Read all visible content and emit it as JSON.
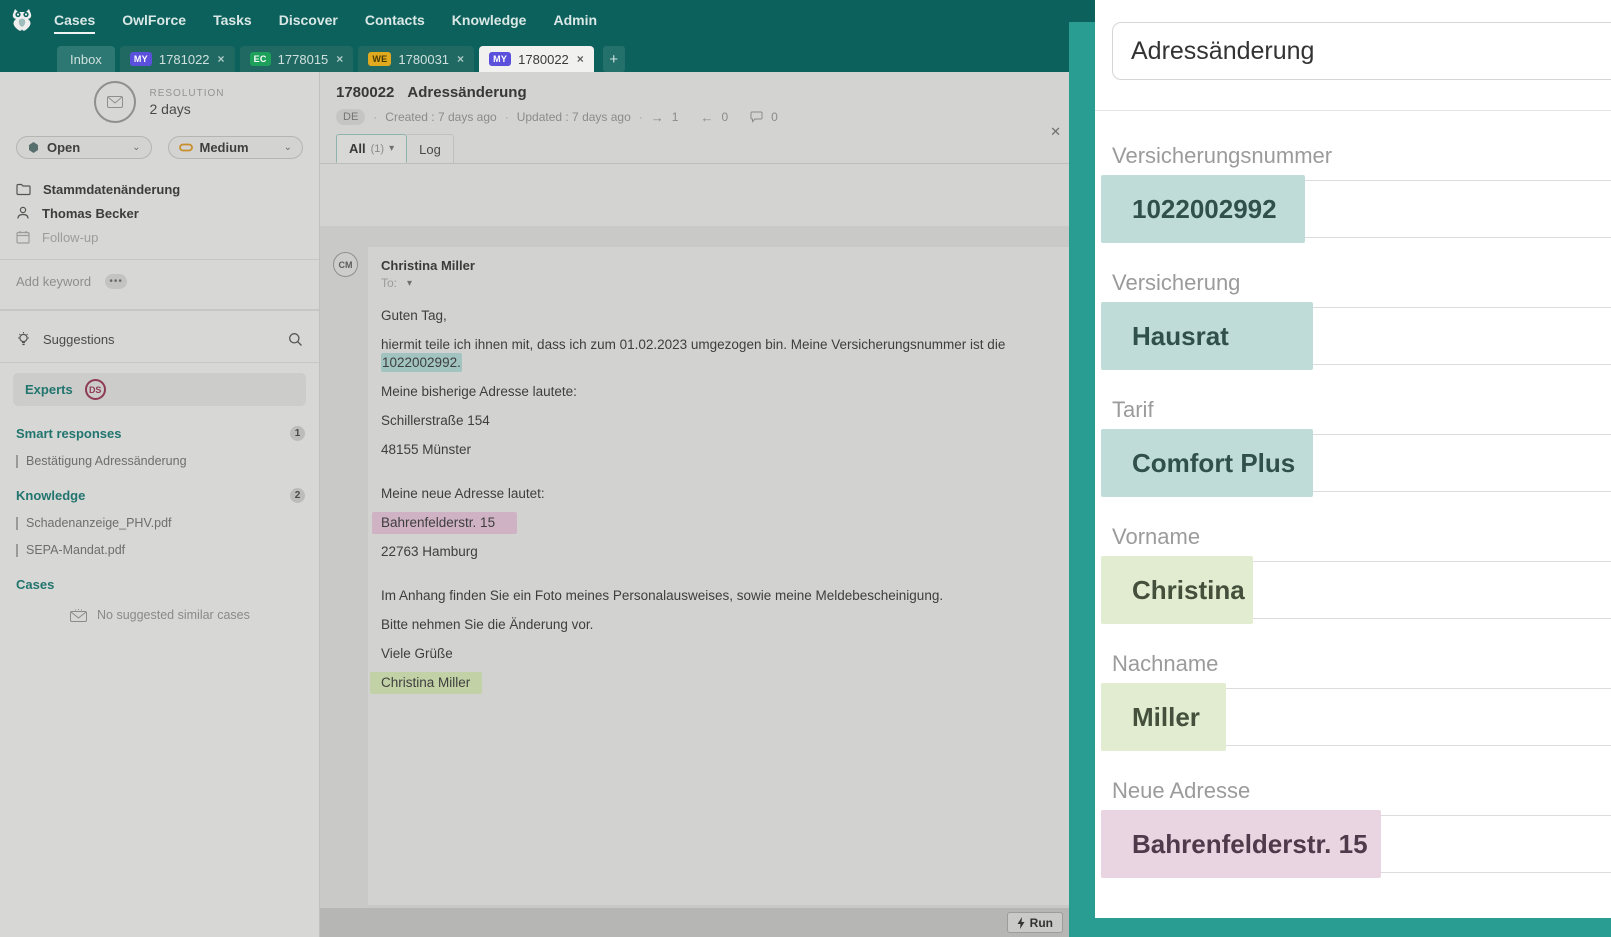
{
  "nav": {
    "items": [
      {
        "label": "Cases"
      },
      {
        "label": "OwlForce"
      },
      {
        "label": "Tasks"
      },
      {
        "label": "Discover"
      },
      {
        "label": "Contacts"
      },
      {
        "label": "Knowledge"
      },
      {
        "label": "Admin"
      }
    ]
  },
  "tabs": {
    "inbox_label": "Inbox",
    "add_label": "+",
    "close_glyph": "×",
    "cases": [
      {
        "badge": "MY",
        "number": "1781022"
      },
      {
        "badge": "EC",
        "number": "1778015"
      },
      {
        "badge": "WE",
        "number": "1780031"
      },
      {
        "badge": "MY",
        "number": "1780022"
      }
    ]
  },
  "sidebar": {
    "resolution_label": "RESOLUTION",
    "resolution_value": "2 days",
    "status_value": "Open",
    "priority_value": "Medium",
    "details": [
      {
        "label": "Stammdatenänderung"
      },
      {
        "label": "Thomas Becker"
      },
      {
        "label": "Follow-up"
      }
    ],
    "add_keyword_label": "Add keyword",
    "dots_glyph": "•••",
    "suggestions_title": "Suggestions",
    "experts_label": "Experts",
    "experts_badge": "DS",
    "smart_responses": {
      "title": "Smart responses",
      "count": "1",
      "items": [
        "Bestätigung Adressänderung"
      ]
    },
    "knowledge": {
      "title": "Knowledge",
      "count": "2",
      "items": [
        "Schadenanzeige_PHV.pdf",
        "SEPA-Mandat.pdf"
      ]
    },
    "cases_section": {
      "title": "Cases",
      "empty_text": "No suggested similar cases"
    }
  },
  "case_header": {
    "id": "1780022",
    "title": "Adressänderung",
    "language": "DE",
    "created": "Created : 7 days ago",
    "updated": "Updated : 7 days ago",
    "dot": "·",
    "sent_arrow": "→",
    "sent_count": "1",
    "received_arrow": "←",
    "received_count": "0",
    "comments_count": "0",
    "tab_all": "All",
    "tab_all_count": "(1)",
    "tab_log": "Log",
    "collapse_glyph": "✕"
  },
  "email": {
    "avatar": "CM",
    "sender": "Christina Miller",
    "to_label": "To:",
    "paragraphs": [
      {
        "text": "Guten Tag,"
      },
      {
        "pre": "hiermit teile ich ihnen mit, dass ich zum 01.02.2023 umgezogen bin. Meine Versicherungsnummer ist die ",
        "hl": "1022002992."
      },
      {
        "text": "Meine bisherige Adresse lautete:"
      },
      {
        "text": "Schillerstraße 154"
      },
      {
        "text": "48155 Münster"
      },
      {
        "text": "Meine neue Adresse lautet:"
      },
      {
        "hl": "Bahrenfelderstr. 15"
      },
      {
        "text": "22763 Hamburg"
      },
      {
        "text": "Im Anhang finden Sie ein Foto meines Personalausweises, sowie meine Meldebescheinigung."
      },
      {
        "text": "Bitte nehmen Sie die Änderung vor."
      },
      {
        "text": "Viele Grüße"
      },
      {
        "hl": "Christina Miller"
      }
    ]
  },
  "footer": {
    "run_label": "Run"
  },
  "panel": {
    "title": "Adressänderung",
    "fields": [
      {
        "label": "Versicherungsnummer",
        "value": "1022002992",
        "color": "teal"
      },
      {
        "label": "Versicherung",
        "value": "Hausrat",
        "color": "teal"
      },
      {
        "label": "Tarif",
        "value": "Comfort Plus",
        "color": "teal"
      },
      {
        "label": "Vorname",
        "value": "Christina",
        "color": "green"
      },
      {
        "label": "Nachname",
        "value": "Miller",
        "color": "green"
      },
      {
        "label": "Neue Adresse",
        "value": "Bahrenfelderstr. 15",
        "color": "pink"
      }
    ]
  },
  "colors": {
    "nav_teal": "#0d615c",
    "panel_teal": "#2a9d92",
    "badge_my": "#5a50dc",
    "badge_ec": "#1ca05a",
    "badge_we": "#e0a91e",
    "highlight_teal": "#c0dcd8",
    "highlight_green": "#e2ecd1",
    "highlight_pink": "#e9d5e2",
    "accent_teal_text": "#22756e",
    "experts_maroon": "#8e3a57"
  }
}
